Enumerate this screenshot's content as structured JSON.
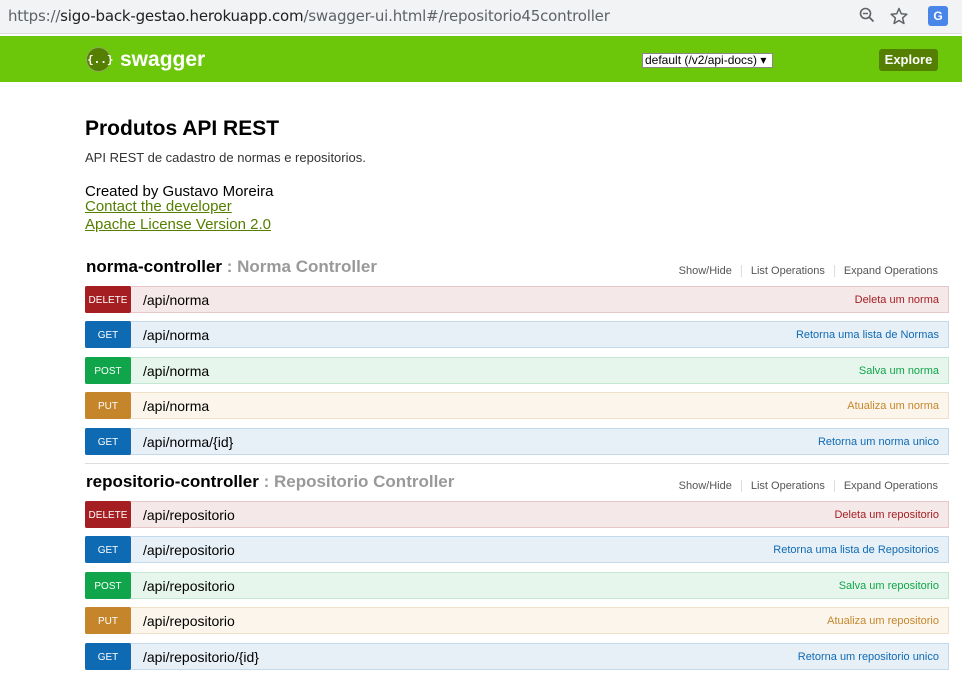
{
  "browser": {
    "url_scheme": "https://",
    "url_host": "sigo-back-gestao.herokuapp.com",
    "url_path": "/swagger-ui.html#/repositorio45controller"
  },
  "header": {
    "logo_text": "swagger",
    "spec_selected": "default (/v2/api-docs) ▾",
    "explore_label": "Explore"
  },
  "info": {
    "title": "Produtos API REST",
    "description": "API REST de cadastro de normas e repositorios.",
    "created_by": "Created by Gustavo Moreira",
    "contact_link": "Contact the developer",
    "license_link": "Apache License Version 2.0"
  },
  "controllers": [
    {
      "name": "norma-controller",
      "description": ": Norma Controller",
      "actions": [
        "Show/Hide",
        "List Operations",
        "Expand Operations"
      ],
      "operations": [
        {
          "method": "DELETE",
          "path": "/api/norma",
          "summary": "Deleta um norma"
        },
        {
          "method": "GET",
          "path": "/api/norma",
          "summary": "Retorna uma lista de Normas"
        },
        {
          "method": "POST",
          "path": "/api/norma",
          "summary": "Salva um norma"
        },
        {
          "method": "PUT",
          "path": "/api/norma",
          "summary": "Atualiza um norma"
        },
        {
          "method": "GET",
          "path": "/api/norma/{id}",
          "summary": "Retorna um norma unico"
        }
      ]
    },
    {
      "name": "repositorio-controller",
      "description": ": Repositorio Controller",
      "actions": [
        "Show/Hide",
        "List Operations",
        "Expand Operations"
      ],
      "operations": [
        {
          "method": "DELETE",
          "path": "/api/repositorio",
          "summary": "Deleta um repositorio"
        },
        {
          "method": "GET",
          "path": "/api/repositorio",
          "summary": "Retorna uma lista de Repositorios"
        },
        {
          "method": "POST",
          "path": "/api/repositorio",
          "summary": "Salva um repositorio"
        },
        {
          "method": "PUT",
          "path": "/api/repositorio",
          "summary": "Atualiza um repositorio"
        },
        {
          "method": "GET",
          "path": "/api/repositorio/{id}",
          "summary": "Retorna um repositorio unico"
        }
      ]
    }
  ]
}
